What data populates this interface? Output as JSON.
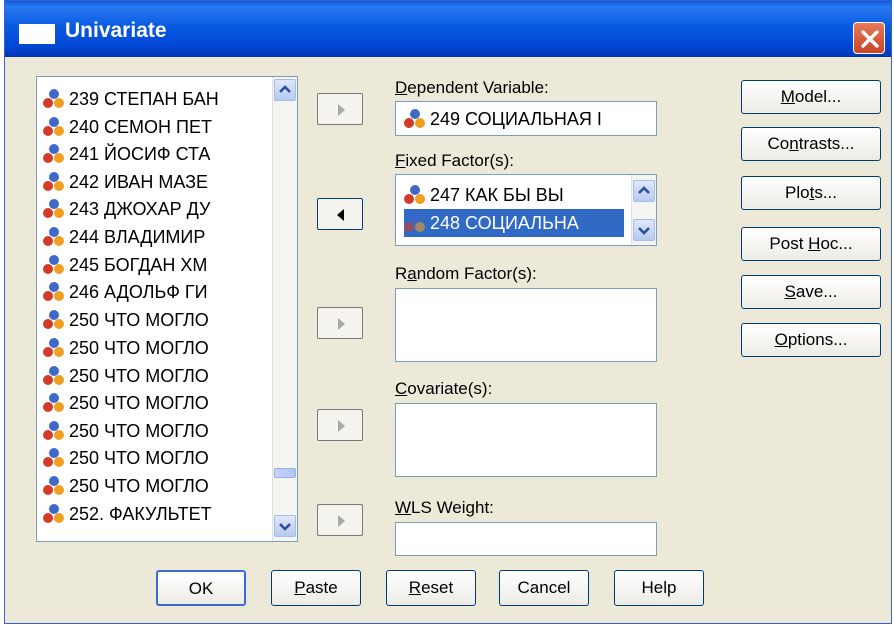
{
  "window": {
    "title": "Univariate"
  },
  "variable_list": {
    "items": [
      "239 СТЕПАН БАН",
      "240 СЕМОН ПЕТ",
      "241 ЙОСИФ СТА",
      "242 ИВАН МАЗЕ",
      "243 ДЖОХАР ДУ",
      "244 ВЛАДИМИР",
      "245 БОГДАН ХМ",
      "246 АДОЛЬФ ГИ",
      "250 ЧТО МОГЛО",
      "250 ЧТО МОГЛО",
      "250 ЧТО МОГЛО",
      "250 ЧТО МОГЛО",
      "250 ЧТО МОГЛО",
      "250 ЧТО МОГЛО",
      "250 ЧТО МОГЛО",
      "252. ФАКУЛЬТЕТ"
    ]
  },
  "dependent": {
    "label_prefix": "D",
    "label_rest": "ependent Variable:",
    "value": "249 СОЦИАЛЬНАЯ І"
  },
  "fixed": {
    "label_prefix": "F",
    "label_rest": "ixed Factor(s):",
    "items": [
      "247 КАК БЫ ВЫ",
      "248 СОЦИАЛЬНА"
    ]
  },
  "random": {
    "label_a": "R",
    "label_u": "a",
    "label_b": "ndom Factor(s):"
  },
  "covariate": {
    "label_prefix": "C",
    "label_rest": "ovariate(s):"
  },
  "wls": {
    "label_prefix": "W",
    "label_rest": "LS Weight:"
  },
  "side_buttons": {
    "model": {
      "a": "",
      "u": "M",
      "b": "odel..."
    },
    "contrasts": {
      "a": "Co",
      "u": "n",
      "b": "trasts..."
    },
    "plots": {
      "a": "Plo",
      "u": "t",
      "b": "s..."
    },
    "posthoc": {
      "a": "Post ",
      "u": "H",
      "b": "oc..."
    },
    "save": {
      "a": "",
      "u": "S",
      "b": "ave..."
    },
    "options": {
      "a": "",
      "u": "O",
      "b": "ptions..."
    }
  },
  "bottom_buttons": {
    "ok": {
      "a": "OK",
      "u": "",
      "b": ""
    },
    "paste": {
      "a": "",
      "u": "P",
      "b": "aste"
    },
    "reset": {
      "a": "",
      "u": "R",
      "b": "eset"
    },
    "cancel": {
      "a": "Cancel",
      "u": "",
      "b": ""
    },
    "help": {
      "a": "Help",
      "u": "",
      "b": ""
    }
  },
  "colors": {
    "titlebar": "#0a5ae0",
    "selection": "#316ac5",
    "dialog_bg": "#ece9d8"
  }
}
